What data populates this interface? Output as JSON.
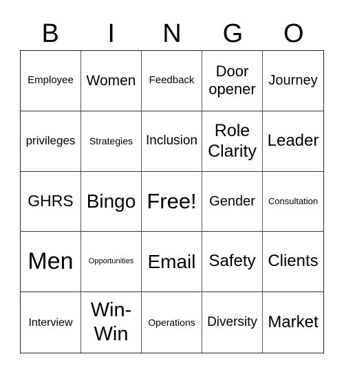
{
  "header": {
    "letters": [
      "B",
      "I",
      "N",
      "G",
      "O"
    ]
  },
  "cells": [
    {
      "text": "Employee",
      "size": "s15"
    },
    {
      "text": "Women",
      "size": "s21"
    },
    {
      "text": "Feedback",
      "size": "s15"
    },
    {
      "text": "Door opener",
      "size": "s22"
    },
    {
      "text": "Journey",
      "size": "s20"
    },
    {
      "text": "privileges",
      "size": "s17"
    },
    {
      "text": "Strategies",
      "size": "s14"
    },
    {
      "text": "Inclusion",
      "size": "s19"
    },
    {
      "text": "Role Clarity",
      "size": "s25"
    },
    {
      "text": "Leader",
      "size": "s24"
    },
    {
      "text": "GHRS",
      "size": "s23"
    },
    {
      "text": "Bingo",
      "size": "s28"
    },
    {
      "text": "Free!",
      "size": "s31"
    },
    {
      "text": "Gender",
      "size": "s20"
    },
    {
      "text": "Consultation",
      "size": "s13"
    },
    {
      "text": "Men",
      "size": "s34"
    },
    {
      "text": "Opportunities",
      "size": "s11"
    },
    {
      "text": "Email",
      "size": "s28"
    },
    {
      "text": "Safety",
      "size": "s24"
    },
    {
      "text": "Clients",
      "size": "s24"
    },
    {
      "text": "Interview",
      "size": "s16"
    },
    {
      "text": "Win-Win",
      "size": "s29"
    },
    {
      "text": "Operations",
      "size": "s14"
    },
    {
      "text": "Diversity",
      "size": "s19"
    },
    {
      "text": "Market",
      "size": "s24"
    }
  ]
}
